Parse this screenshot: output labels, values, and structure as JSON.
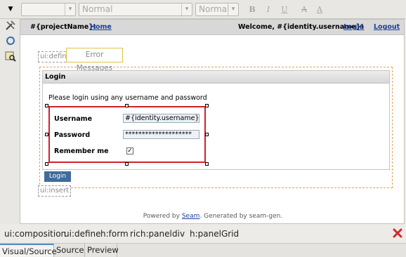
{
  "toolbar": {
    "style_combo_value": "",
    "format_combo_value": "Normal",
    "size_combo_value": "Normal",
    "bold_label": "B",
    "italic_label": "I",
    "underline_label": "U",
    "highlight_label": "A",
    "fontcolor_label": "A"
  },
  "palette": {
    "icons": [
      "tools-icon",
      "sync-icon",
      "preview-icon"
    ]
  },
  "page": {
    "project_name": "#{projectName}:",
    "home_link": "Home",
    "welcome_text": "Welcome, #{identity.username}!",
    "login_link": "Login",
    "logout_link": "Logout",
    "define_tag": "ui:define",
    "error_messages": "Error Messages",
    "insert_tag": "ui:insert",
    "panel": {
      "title": "Login",
      "intro": "Please login using any username and password",
      "rows": [
        {
          "label": "Username",
          "value": "#{identity.username}"
        },
        {
          "label": "Password",
          "value": "********************"
        },
        {
          "label": "Remember me",
          "checked": true
        }
      ]
    },
    "login_button": "Login",
    "footer": {
      "prefix": "Powered by ",
      "link": "Seam",
      "suffix": ". Generated by seam-gen."
    }
  },
  "breadcrumbs": [
    "ui:composition",
    "ui:define",
    "h:form",
    "rich:panel",
    "div",
    "h:panelGrid"
  ],
  "tabs": [
    {
      "label": "Visual/Source",
      "active": true
    },
    {
      "label": "Source",
      "active": false
    },
    {
      "label": "Preview",
      "active": false
    }
  ],
  "colors": {
    "selection_border": "#d4202a",
    "link": "#1b3f9a",
    "button": "#3f6c9b"
  }
}
